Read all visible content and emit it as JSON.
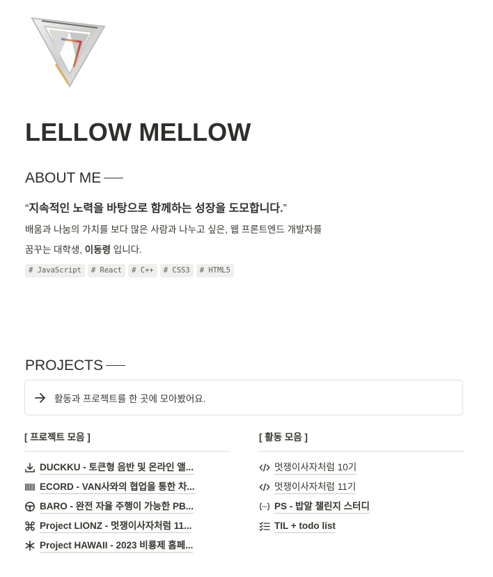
{
  "page": {
    "title": "LELLOW MELLOW"
  },
  "about": {
    "heading": "ABOUT ME",
    "quote_open": "“",
    "quote_text": "지속적인 노력을 바탕으로 함께하는 성장을 도모합니다.",
    "quote_close": "”",
    "line1": "배움과 나눔의 가치를 보다 많은 사람과 나누고 싶은, 웹 프론트엔드 개발자를",
    "line2_prefix": "꿈꾸는 대학생, ",
    "line2_name": "이동령",
    "line2_suffix": " 입니다.",
    "tags": [
      "# JavaScript",
      "# React",
      "# C++",
      "# CSS3",
      "# HTML5"
    ]
  },
  "projects": {
    "heading": "PROJECTS",
    "callout_text": "활동과 프로젝트를 한 곳에 모아봤어요.",
    "left_column": {
      "header": "[ 프로젝트 모음 ]",
      "items": [
        {
          "icon": "download-icon",
          "label": "DUCKKU - 토큰형 음반 및 온라인 앨..."
        },
        {
          "icon": "barcode-icon",
          "label": "ECORD - VAN사와의 협업을 통한 차..."
        },
        {
          "icon": "steering-wheel-icon",
          "label": "BARO - 완전 자율 주행이 가능한 PB..."
        },
        {
          "icon": "command-icon",
          "label": "Project LIONZ - 멋쟁이사자처럼 11..."
        },
        {
          "icon": "asterisk-icon",
          "label": "Project HAWAII - 2023 비룡제 홈페..."
        }
      ]
    },
    "right_column": {
      "header": "[ 활동 모음 ]",
      "items": [
        {
          "icon": "code-icon",
          "label": "멋쟁이사자처럼 10기"
        },
        {
          "icon": "code-icon",
          "label": "멋쟁이사자처럼 11기"
        },
        {
          "icon": "code-braces-icon",
          "label": "PS - 밥알 챌린지 스터디"
        },
        {
          "icon": "checklist-icon",
          "label": "TIL + todo list"
        }
      ]
    }
  }
}
